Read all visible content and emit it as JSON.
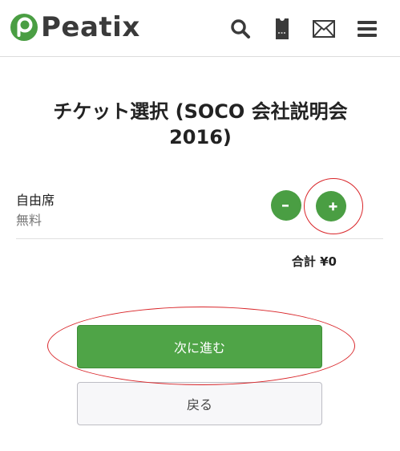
{
  "header": {
    "brand": "Peatix",
    "brand_color": "#4a9e43",
    "icons": [
      "search-icon",
      "ticket-icon",
      "mail-icon",
      "menu-icon"
    ]
  },
  "page": {
    "title": "チケット選択 (SOCO 会社説明会 2016)"
  },
  "ticket": {
    "name": "自由席",
    "price": "無料",
    "quantity_minus_label": "-",
    "quantity_plus_label": "+"
  },
  "total": {
    "label": "合計",
    "amount": "¥0"
  },
  "actions": {
    "next_label": "次に進む",
    "back_label": "戻る"
  },
  "colors": {
    "accent": "#4a9e43",
    "annotation": "#d9262a"
  }
}
